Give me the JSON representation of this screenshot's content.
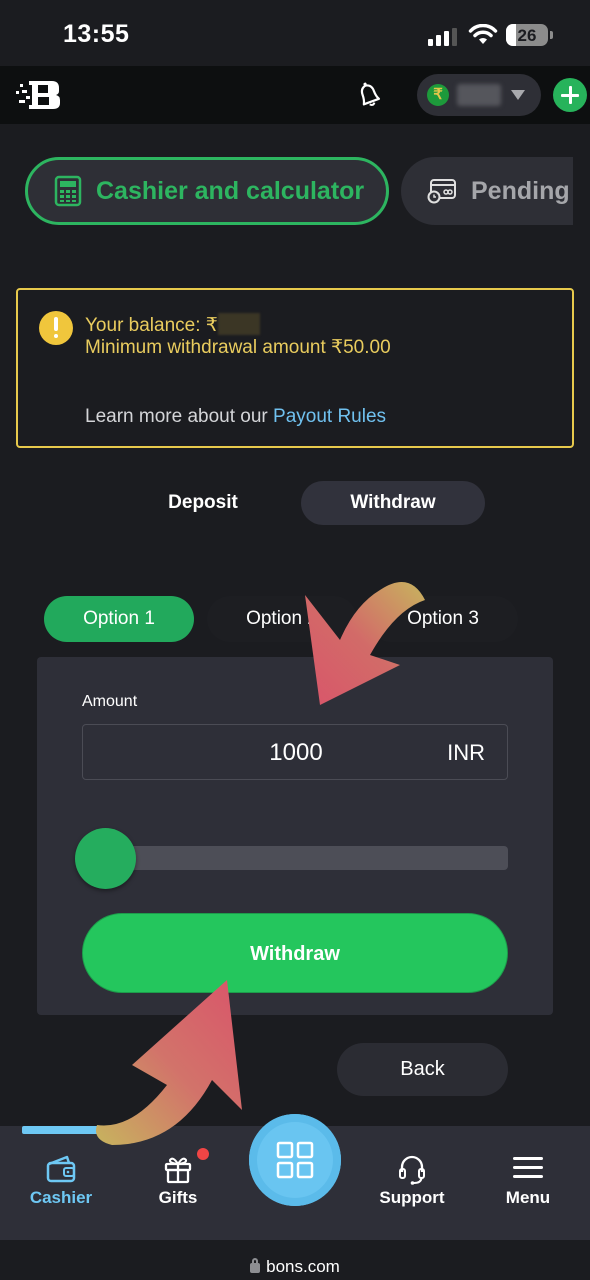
{
  "status_bar": {
    "time": "13:55",
    "battery": "26"
  },
  "header": {
    "logo": "B",
    "currency_symbol": "₹"
  },
  "top_tabs": [
    {
      "label": "Cashier and calculator",
      "icon": "calculator-icon",
      "active": true
    },
    {
      "label": "Pending",
      "icon": "card-clock-icon",
      "active": false
    }
  ],
  "alert": {
    "balance_prefix": "Your balance: ₹",
    "minimum": "Minimum withdrawal amount ₹50.00",
    "learn_more": "Learn more about our ",
    "payout_link": "Payout Rules"
  },
  "mode_switch": {
    "deposit": "Deposit",
    "withdraw": "Withdraw",
    "active": "Withdraw"
  },
  "options": [
    {
      "label": "Option 1",
      "active": true
    },
    {
      "label": "Option 2",
      "active": false
    },
    {
      "label": "Option 3",
      "active": false
    }
  ],
  "withdraw_form": {
    "amount_label": "Amount",
    "amount_value": "1000",
    "currency": "INR",
    "slider_fraction": 0.0,
    "submit_label": "Withdraw"
  },
  "back_label": "Back",
  "bottom_nav": [
    {
      "label": "Cashier",
      "icon": "wallet-icon",
      "active": true
    },
    {
      "label": "Gifts",
      "icon": "gift-icon",
      "badge": true
    },
    {
      "label": "",
      "icon": "grid-icon"
    },
    {
      "label": "Support",
      "icon": "headset-icon"
    },
    {
      "label": "Menu",
      "icon": "hamburger-icon"
    }
  ],
  "browser": {
    "url": "bons.com"
  },
  "colors": {
    "accent_green": "#24c65d",
    "accent_blue": "#6ec8f4",
    "warning_yellow": "#e7c94c",
    "link_blue": "#70c1ef"
  }
}
